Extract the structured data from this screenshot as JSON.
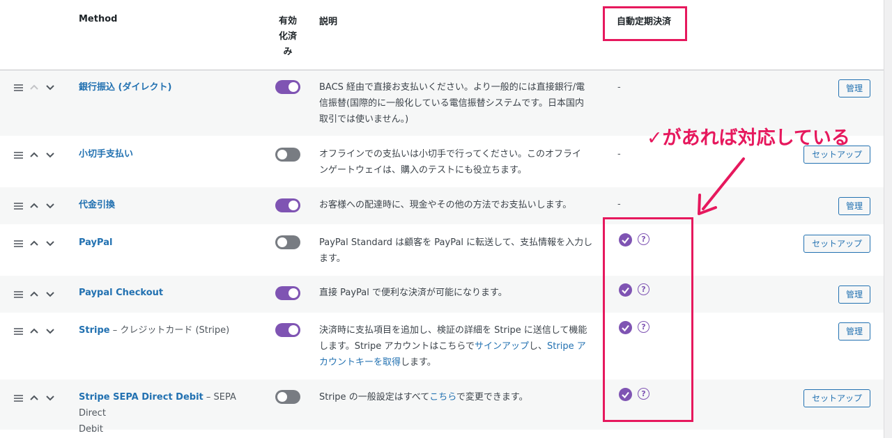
{
  "header": {
    "method": "Method",
    "enabled_line1": "有効",
    "enabled_line2": "化済",
    "enabled_line3": "み",
    "description": "説明",
    "recurring": "自動定期決済"
  },
  "annotation": {
    "text": "✓があれば対応している",
    "color": "#e6185d"
  },
  "rows": [
    {
      "name": "銀行振込 (ダイレクト)",
      "enabled": true,
      "desc_lines": [
        "BACS 経由で直接お支払いください。より一般的には直接銀行/電",
        "信振替(国際的に一般化している電信振替システムです。日本国内",
        "取引では使いません。)"
      ],
      "recurring": "-",
      "action": "管理"
    },
    {
      "name": "小切手支払い",
      "enabled": false,
      "desc_lines": [
        "オフラインでの支払いは小切手で行ってください。このオフライ",
        "ンゲートウェイは、購入のテストにも役立ちます。"
      ],
      "recurring": "-",
      "action": "セットアップ"
    },
    {
      "name": "代金引換",
      "enabled": true,
      "desc_lines": [
        "お客様への配達時に、現金やその他の方法でお支払いします。"
      ],
      "recurring": "-",
      "action": "管理"
    },
    {
      "name": "PayPal",
      "enabled": false,
      "desc_lines": [
        "PayPal Standard は顧客を PayPal に転送して、支払情報を入力し",
        "ます。"
      ],
      "action": "セットアップ"
    },
    {
      "name": "Paypal Checkout",
      "enabled": true,
      "desc_lines": [
        "直接 PayPal で便利な決済が可能になります。"
      ],
      "action": "管理"
    },
    {
      "name": "Stripe",
      "name_suffix": " – クレジットカード (Stripe)",
      "enabled": true,
      "desc_line1": "決済時に支払項目を追加し、検証の詳細を Stripe に送信して機能",
      "desc_line2_pre": "します。Stripe アカウントはこちらで",
      "desc_link1": "サインアップ",
      "desc_line2_mid": "し、",
      "desc_link2a": "Stripe ア",
      "desc_link2b": "カウントキーを取得",
      "desc_line3_post": "します。",
      "action": "管理"
    },
    {
      "name": "Stripe SEPA Direct Debit",
      "name_suffix1": " – SEPA Direct",
      "name_suffix2": "Debit",
      "enabled": false,
      "desc_pre": "Stripe の一般設定はすべて",
      "desc_link": "こちら",
      "desc_post": "で変更できます。",
      "action": "セットアップ"
    }
  ],
  "colors": {
    "accent": "#7f54b3",
    "link": "#2271b1",
    "highlight": "#e6185d"
  }
}
